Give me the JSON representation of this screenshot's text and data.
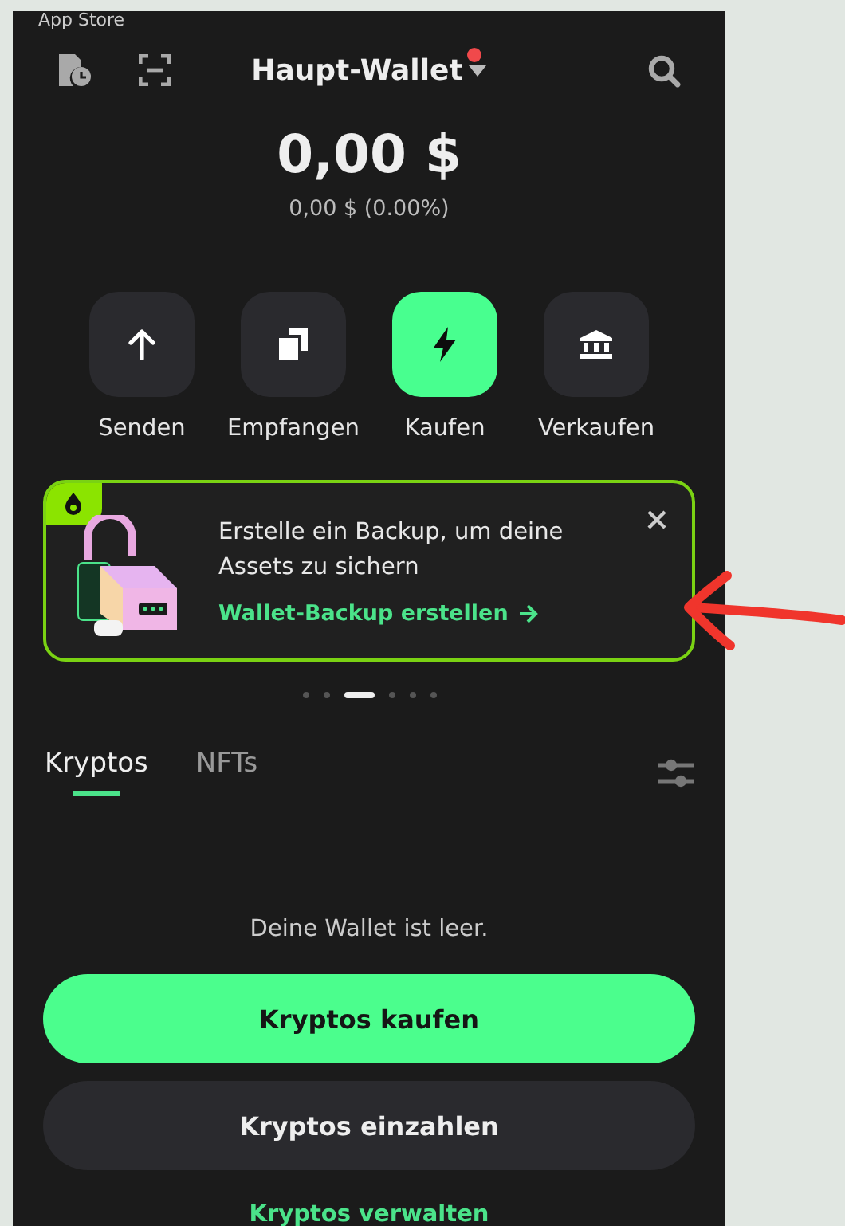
{
  "status_bar": {
    "back_label": "App Store"
  },
  "header": {
    "title": "Haupt-Wallet",
    "has_notification": true
  },
  "balance": {
    "amount": "0,00 $",
    "change": "0,00 $ (0.00%)"
  },
  "actions": [
    {
      "kind": "send",
      "label": "Senden",
      "highlighted": false
    },
    {
      "kind": "receive",
      "label": "Empfangen",
      "highlighted": false
    },
    {
      "kind": "buy",
      "label": "Kaufen",
      "highlighted": true
    },
    {
      "kind": "sell",
      "label": "Verkaufen",
      "highlighted": false
    }
  ],
  "banner": {
    "text": "Erstelle ein Backup, um deine Assets zu sichern",
    "link": "Wallet-Backup erstellen"
  },
  "pagination": [
    {
      "selected": false
    },
    {
      "selected": false
    },
    {
      "selected": true
    },
    {
      "selected": false
    },
    {
      "selected": false
    },
    {
      "selected": false
    }
  ],
  "tabs": [
    {
      "label": "Kryptos",
      "selected": true
    },
    {
      "label": "NFTs",
      "selected": false
    }
  ],
  "empty_state": {
    "message": "Deine Wallet ist leer.",
    "primary_button": "Kryptos kaufen",
    "secondary_button": "Kryptos einzahlen",
    "link": "Kryptos verwalten"
  }
}
